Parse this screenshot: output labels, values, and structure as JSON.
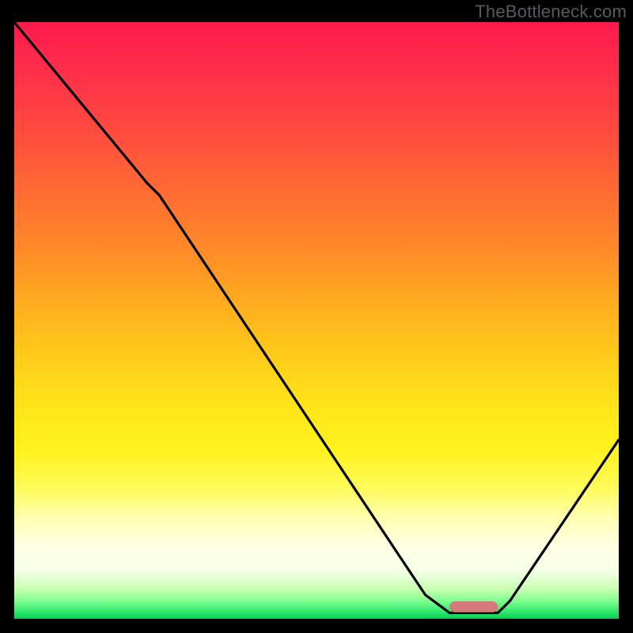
{
  "watermark": "TheBottleneck.com",
  "chart_data": {
    "type": "line",
    "title": "",
    "xlabel": "",
    "ylabel": "",
    "xlim": [
      0,
      100
    ],
    "ylim": [
      0,
      100
    ],
    "series": [
      {
        "name": "bottleneck-curve",
        "x": [
          0,
          22,
          24,
          68,
          72,
          80,
          82,
          100
        ],
        "values": [
          100,
          73,
          71,
          4,
          1,
          1,
          3,
          30
        ]
      }
    ],
    "marker": {
      "name": "optimal-range",
      "x_start": 72,
      "x_end": 80,
      "y": 2,
      "color": "#d47a7a"
    },
    "background_gradient": {
      "top_color": "#ff1a4d",
      "mid_color": "#ffe81a",
      "bottom_color": "#0ad050"
    }
  }
}
